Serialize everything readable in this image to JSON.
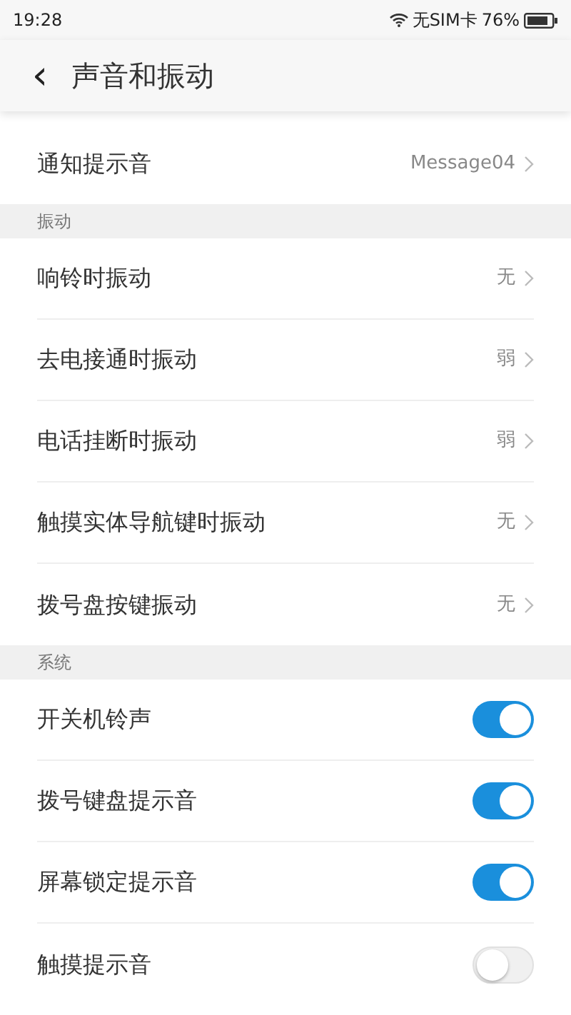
{
  "status_bar": {
    "time": "19:28",
    "carrier": "无SIM卡",
    "battery": "76%"
  },
  "header": {
    "back": "‹",
    "title": "声音和振动"
  },
  "sections": [
    {
      "items": [
        {
          "kind": "link",
          "label": "通知提示音",
          "value": "Message04"
        }
      ]
    },
    {
      "title": "振动",
      "items": [
        {
          "kind": "link",
          "label": "响铃时振动",
          "value": "无"
        },
        {
          "kind": "link",
          "label": "去电接通时振动",
          "value": "弱"
        },
        {
          "kind": "link",
          "label": "电话挂断时振动",
          "value": "弱"
        },
        {
          "kind": "link",
          "label": "触摸实体导航键时振动",
          "value": "无"
        },
        {
          "kind": "link",
          "label": "拨号盘按键振动",
          "value": "无"
        }
      ]
    },
    {
      "title": "系统",
      "items": [
        {
          "kind": "toggle",
          "label": "开关机铃声",
          "on": true
        },
        {
          "kind": "toggle",
          "label": "拨号键盘提示音",
          "on": true
        },
        {
          "kind": "toggle",
          "label": "屏幕锁定提示音",
          "on": true
        },
        {
          "kind": "toggle",
          "label": "触摸提示音",
          "on": false
        }
      ]
    }
  ]
}
